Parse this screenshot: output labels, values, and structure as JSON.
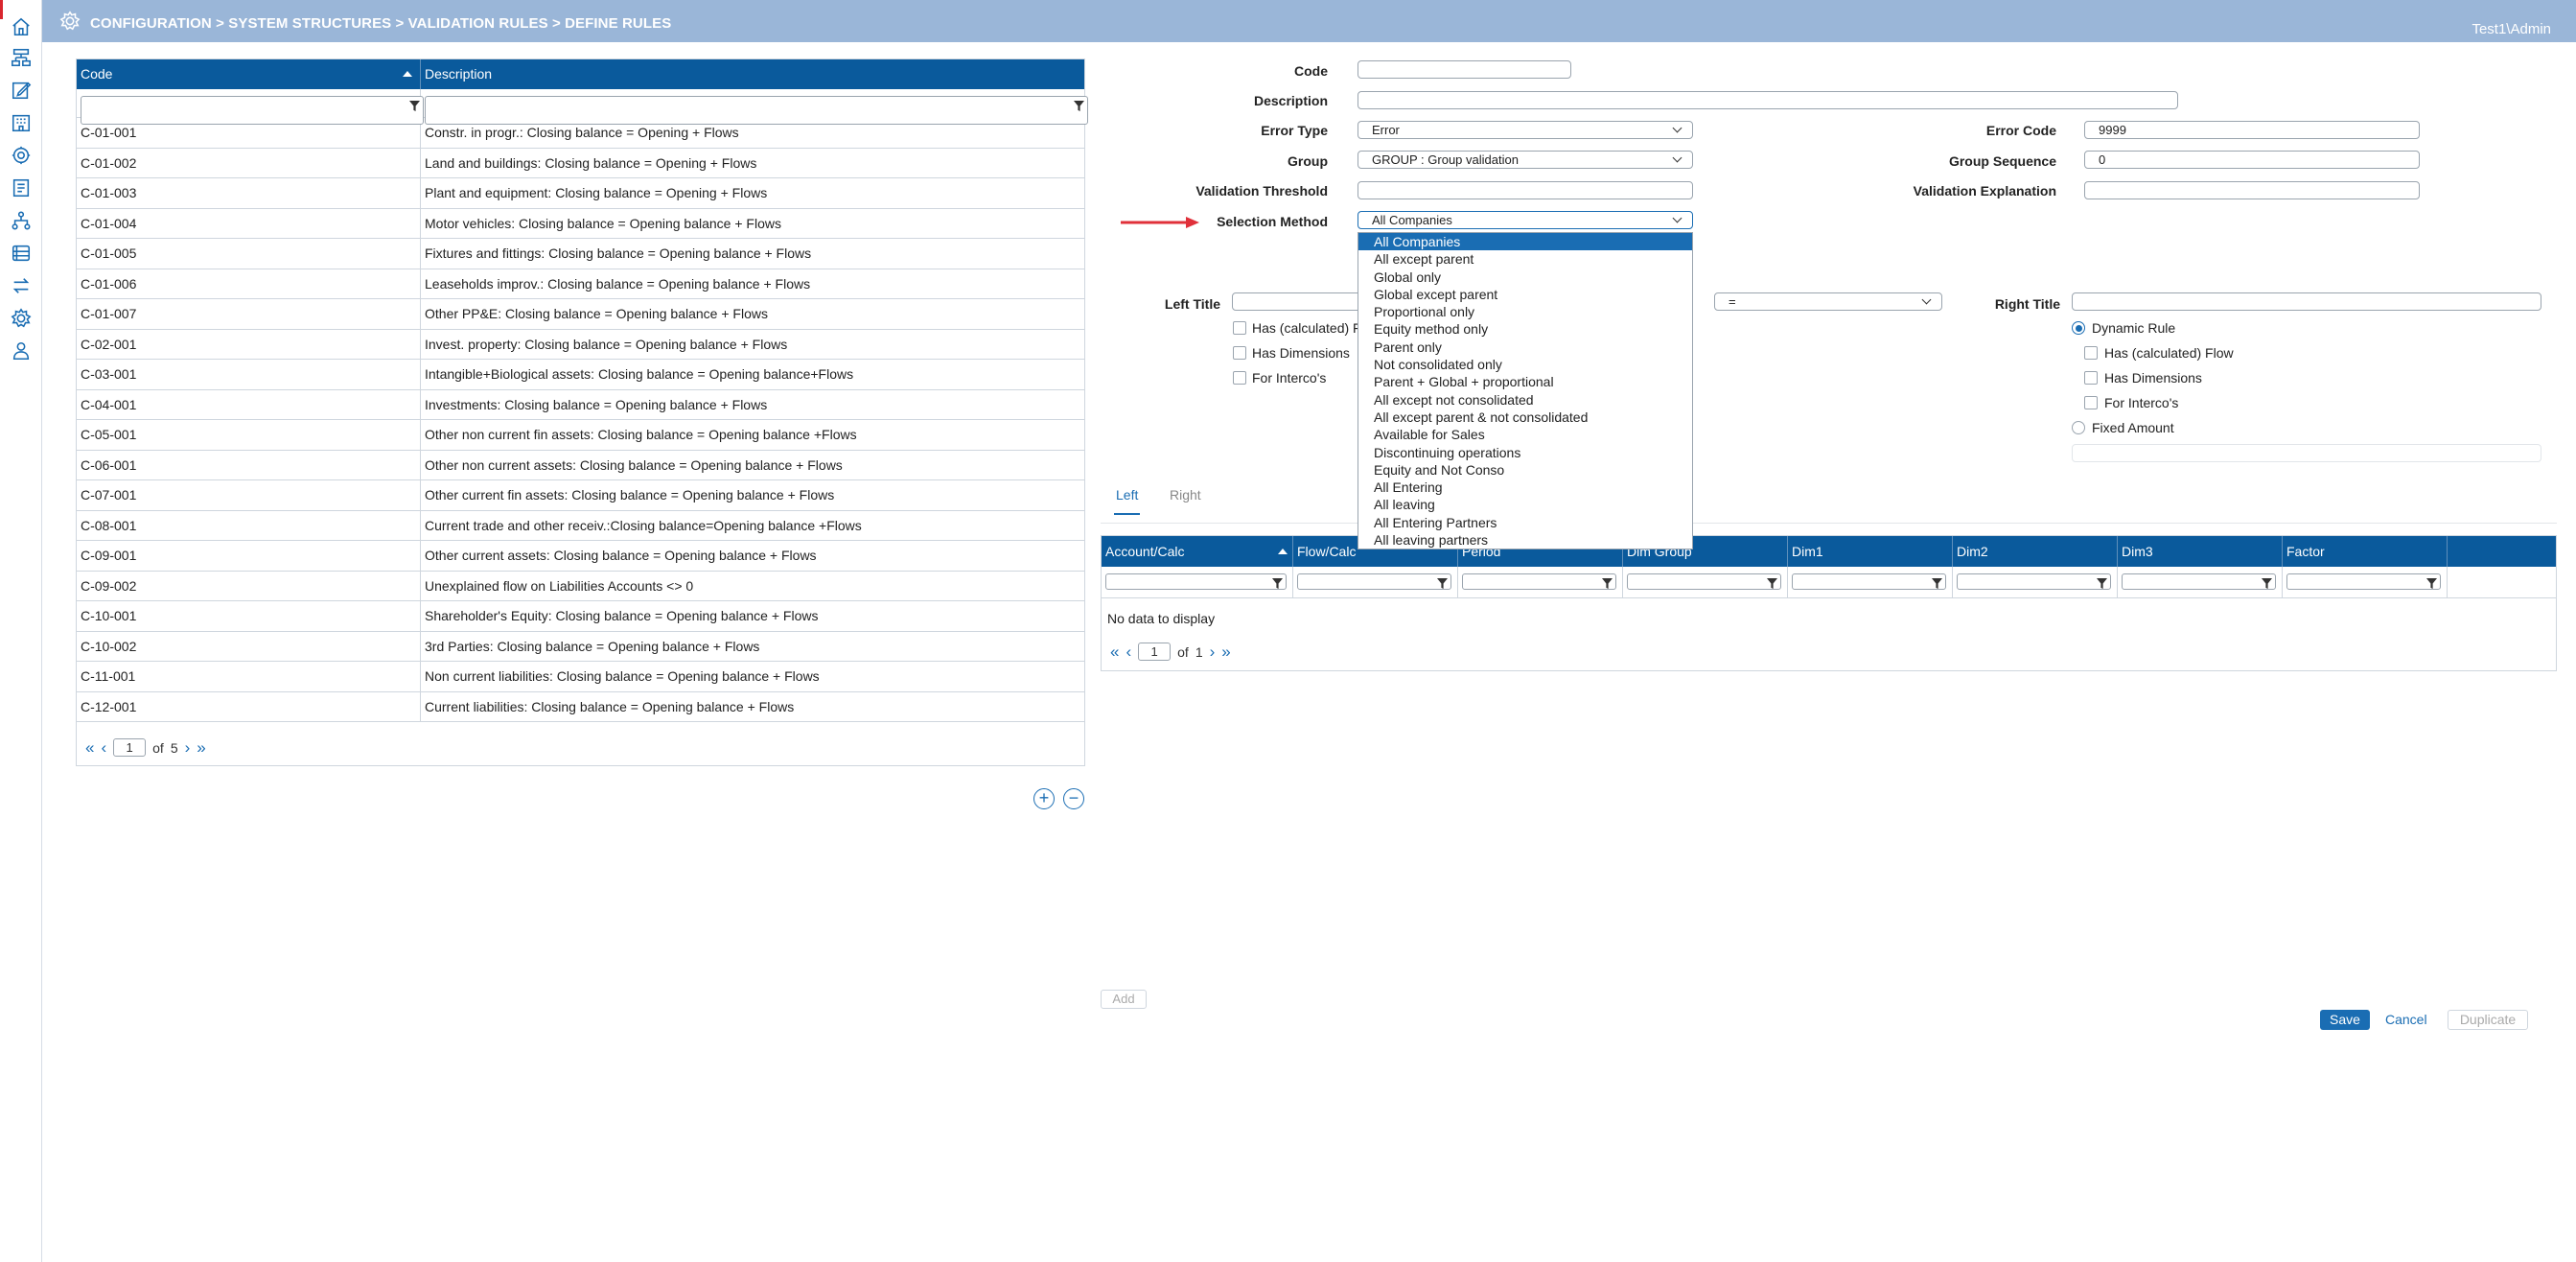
{
  "header": {
    "breadcrumb": "CONFIGURATION > SYSTEM STRUCTURES > VALIDATION RULES > DEFINE RULES",
    "user": "Test1\\Admin"
  },
  "rules_table": {
    "columns": [
      "Code",
      "Description"
    ],
    "rows": [
      {
        "code": "C-01-001",
        "description": "Constr. in progr.: Closing balance = Opening + Flows"
      },
      {
        "code": "C-01-002",
        "description": "Land and buildings: Closing balance = Opening + Flows"
      },
      {
        "code": "C-01-003",
        "description": "Plant and equipment: Closing balance = Opening + Flows"
      },
      {
        "code": "C-01-004",
        "description": "Motor vehicles: Closing balance = Opening balance + Flows"
      },
      {
        "code": "C-01-005",
        "description": "Fixtures and fittings: Closing balance = Opening balance + Flows"
      },
      {
        "code": "C-01-006",
        "description": "Leaseholds improv.: Closing balance = Opening balance + Flows"
      },
      {
        "code": "C-01-007",
        "description": "Other PP&E: Closing balance = Opening balance + Flows"
      },
      {
        "code": "C-02-001",
        "description": "Invest. property: Closing balance = Opening balance + Flows"
      },
      {
        "code": "C-03-001",
        "description": "Intangible+Biological assets: Closing balance = Opening balance+Flows"
      },
      {
        "code": "C-04-001",
        "description": "Investments: Closing balance = Opening balance + Flows"
      },
      {
        "code": "C-05-001",
        "description": "Other non current fin assets: Closing balance = Opening balance +Flows"
      },
      {
        "code": "C-06-001",
        "description": "Other non current assets: Closing balance = Opening balance + Flows"
      },
      {
        "code": "C-07-001",
        "description": "Other current fin assets: Closing balance = Opening balance + Flows"
      },
      {
        "code": "C-08-001",
        "description": "Current trade and other receiv.:Closing balance=Opening balance +Flows"
      },
      {
        "code": "C-09-001",
        "description": "Other current assets: Closing balance = Opening balance + Flows"
      },
      {
        "code": "C-09-002",
        "description": "Unexplained flow on Liabilities Accounts <> 0"
      },
      {
        "code": "C-10-001",
        "description": "Shareholder's Equity: Closing balance = Opening balance + Flows"
      },
      {
        "code": "C-10-002",
        "description": "3rd Parties: Closing balance = Opening balance + Flows"
      },
      {
        "code": "C-11-001",
        "description": "Non current liabilities: Closing balance = Opening balance + Flows"
      },
      {
        "code": "C-12-001",
        "description": "Current liabilities: Closing balance = Opening balance + Flows"
      }
    ],
    "pager": {
      "page": "1",
      "of_label": "of",
      "total": "5"
    }
  },
  "form": {
    "code_label": "Code",
    "code_value": "",
    "description_label": "Description",
    "description_value": "",
    "error_type_label": "Error Type",
    "error_type_value": "Error",
    "error_code_label": "Error Code",
    "error_code_value": "9999",
    "group_label": "Group",
    "group_value": "GROUP : Group validation",
    "group_sequence_label": "Group Sequence",
    "group_sequence_value": "0",
    "validation_threshold_label": "Validation Threshold",
    "validation_threshold_value": "",
    "validation_explanation_label": "Validation Explanation",
    "validation_explanation_value": "",
    "selection_method_label": "Selection Method",
    "selection_method_value": "All Companies",
    "selection_method_options": [
      "All Companies",
      "All except parent",
      "Global only",
      "Global except parent",
      "Proportional only",
      "Equity method only",
      "Parent only",
      "Not consolidated only",
      "Parent + Global + proportional",
      "All except not consolidated",
      "All except parent & not consolidated",
      "Available for Sales",
      "Discontinuing operations",
      "Equity and Not Conso",
      "All Entering",
      "All leaving",
      "All Entering Partners",
      "All leaving partners"
    ],
    "left_title_label": "Left Title",
    "left_title_value": "",
    "operator_value": "=",
    "right_title_label": "Right Title",
    "right_title_value": "",
    "left_options": {
      "has_calc_flow": "Has (calculated) F",
      "has_dimensions": "Has Dimensions",
      "for_intercos": "For Interco's"
    },
    "right_options": {
      "dynamic_rule": "Dynamic Rule",
      "has_calc_flow": "Has (calculated) Flow",
      "has_dimensions": "Has Dimensions",
      "for_intercos": "For Interco's",
      "fixed_amount": "Fixed Amount"
    }
  },
  "tabs": [
    "Left",
    "Right"
  ],
  "detail_table": {
    "columns": [
      "Account/Calc",
      "Flow/Calc",
      "Period",
      "Dim Group",
      "Dim1",
      "Dim2",
      "Dim3",
      "Factor"
    ],
    "empty_text": "No data to display",
    "pager": {
      "page": "1",
      "of_label": "of",
      "total": "1"
    }
  },
  "buttons": {
    "add": "Add",
    "save": "Save",
    "cancel": "Cancel",
    "duplicate": "Duplicate",
    "plus": "+",
    "minus": "−"
  },
  "colors": {
    "header_blue": "#0a5a9c",
    "topbar": "#9ab6d8",
    "accent": "#1a6db3",
    "arrow": "#e0303a"
  }
}
